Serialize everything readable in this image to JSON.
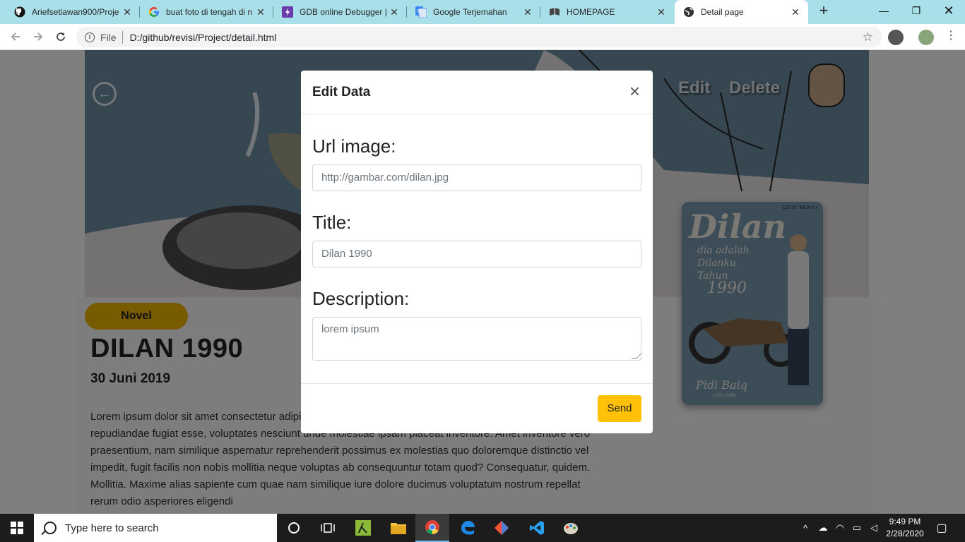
{
  "browser": {
    "tabs": [
      {
        "title": "Ariefsetiawan900/Proje",
        "icon": "github-icon"
      },
      {
        "title": "buat foto di tengah di n",
        "icon": "google-icon"
      },
      {
        "title": "GDB online Debugger |",
        "icon": "gdb-icon"
      },
      {
        "title": "Google Terjemahan",
        "icon": "google-translate-icon"
      },
      {
        "title": "HOMEPAGE",
        "icon": "book-icon"
      },
      {
        "title": "Detail page",
        "icon": "globe-icon"
      }
    ],
    "active_tab": 5,
    "address": {
      "scheme": "File",
      "url": "D:/github/revisi/Project/detail.html"
    }
  },
  "page": {
    "nav": {
      "edit_label": "Edit",
      "delete_label": "Delete"
    },
    "category_badge": "Novel",
    "title": "DILAN 1990",
    "date": "30 Juni 2019",
    "body": "Lorem ipsum dolor sit amet consectetur adipisicing elit. Quaerat, necessitatibus cum iusto, in fugit aliquam repudiandae fugiat esse, voluptates nesciunt unde molestiae ipsam placeat inventore. Amet inventore vero praesentium, nam similique aspernatur reprehenderit possimus ex molestias quo doloremque distinctio vel impedit, fugit facilis non nobis mollitia neque voluptas ab consequuntur totam quod? Consequatur, quidem. Mollitia. Maxime alias sapiente cum quae nam similique iure dolore ducimus voluptatum nostrum repellat rerum odio asperiores eligendi",
    "cover": {
      "title": "Dilan",
      "edition": "EDISI REVISI",
      "tagline_1": "dia adalah",
      "tagline_2": "Dilanku",
      "tagline_3": "Tahun",
      "year": "1990",
      "author": "Pidi Baiq",
      "author_years": "(1972-2098)"
    }
  },
  "modal": {
    "title": "Edit Data",
    "fields": {
      "url_label": "Url image:",
      "url_placeholder": "http://gambar.com/dilan.jpg",
      "title_label": "Title:",
      "title_placeholder": "Dilan 1990",
      "description_label": "Description:",
      "description_placeholder": "lorem ipsum"
    },
    "submit_label": "Send"
  },
  "taskbar": {
    "search_placeholder": "Type here to search",
    "time": "9:49 PM",
    "date": "2/28/2020"
  },
  "colors": {
    "tabstrip": "#a8dfe8",
    "badge": "#f0b400",
    "send_button": "#ffc107",
    "hero": "#6f8ea3"
  }
}
